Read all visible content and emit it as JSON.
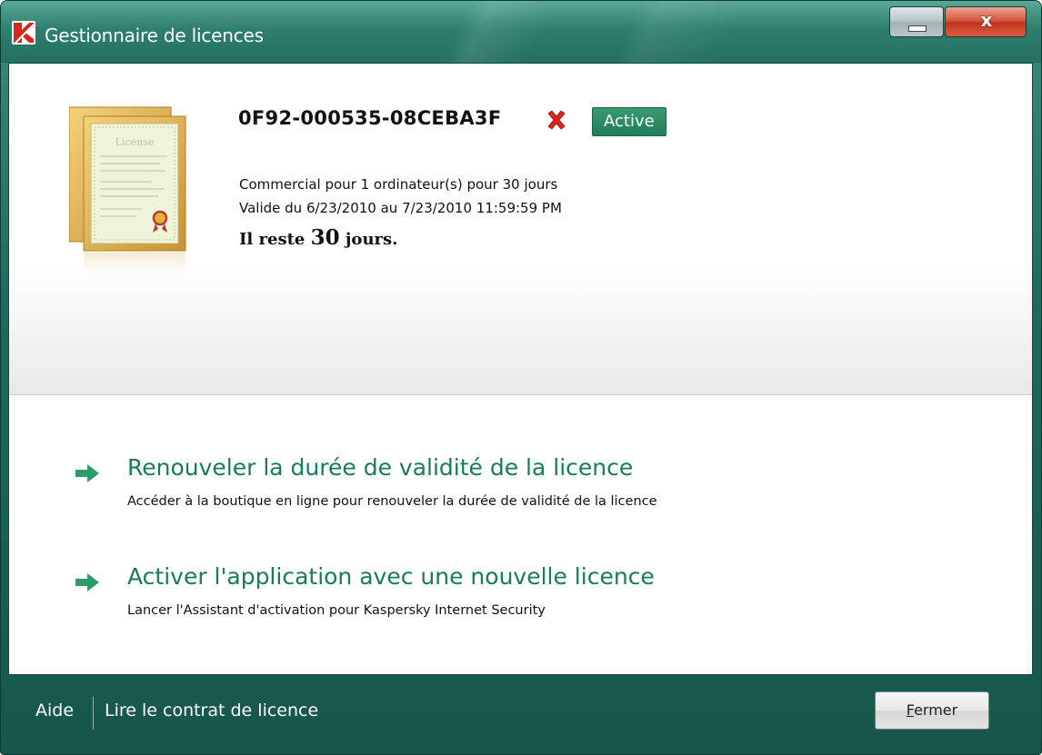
{
  "window": {
    "title": "Gestionnaire de licences",
    "title_buttons": {
      "close": "x"
    }
  },
  "license": {
    "key": "0F92-000535-08CEBA3F",
    "status": "Active",
    "type_line": "Commercial pour 1 ordinateur(s) pour 30 jours",
    "validity_line": "Valide du 6/23/2010 au 7/23/2010 11:59:59 PM",
    "days_left_prefix": "Il reste ",
    "days_left_value": "30",
    "days_left_suffix": " jours.",
    "image_label": "License"
  },
  "actions": [
    {
      "title": "Renouveler la durée de validité de la licence",
      "description": "Accéder à la boutique en ligne pour renouveler la durée de validité de la licence",
      "icon": "arrow-right-icon"
    },
    {
      "title": "Activer l'application avec une nouvelle licence",
      "description": "Lancer l'Assistant d'activation pour Kaspersky Internet Security",
      "icon": "arrow-right-icon"
    }
  ],
  "footer": {
    "help_label": "Aide",
    "license_agreement_label": "Lire le contrat de licence",
    "close_mnemonic": "F",
    "close_rest": "ermer"
  },
  "colors": {
    "frame": "#1f6a5c",
    "action_text": "#1a7a5a",
    "badge": "#1f7d57",
    "arrow": "#2e9c6a",
    "remove": "#d6261e"
  }
}
